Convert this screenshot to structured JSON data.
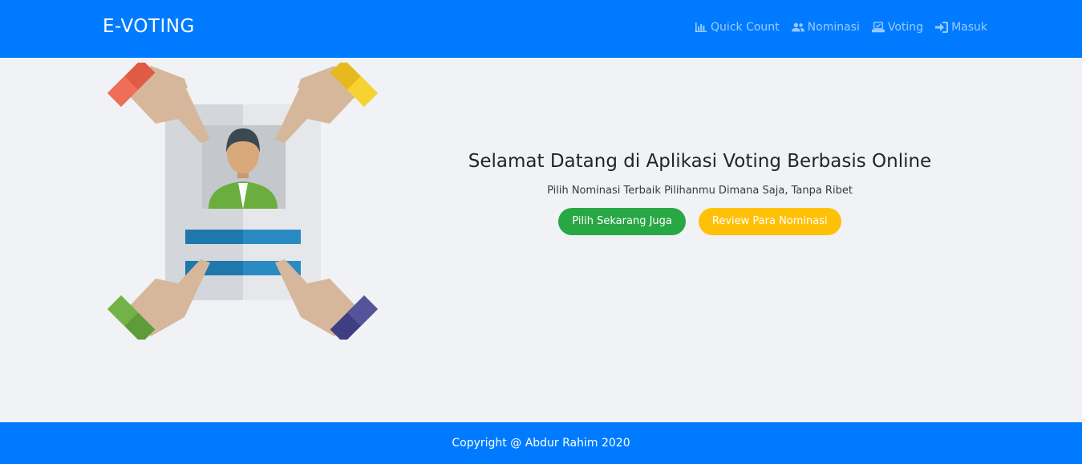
{
  "navbar": {
    "brand": "E-VOTING",
    "items": [
      {
        "label": "Quick Count",
        "icon": "chart-icon"
      },
      {
        "label": "Nominasi",
        "icon": "users-icon"
      },
      {
        "label": "Voting",
        "icon": "vote-box-icon"
      },
      {
        "label": "Masuk",
        "icon": "sign-in-icon"
      }
    ]
  },
  "hero": {
    "title": "Selamat Datang di Aplikasi Voting Berbasis Online",
    "subtitle": "Pilih Nominasi Terbaik Pilihanmu Dimana Saja, Tanpa Ribet",
    "primary_button": "Pilih Sekarang Juga",
    "secondary_button": "Review Para Nominasi"
  },
  "footer": {
    "copyright": "Copyright @ Abdur Rahim 2020"
  },
  "colors": {
    "primary": "#007bff",
    "success": "#28a745",
    "warning": "#ffc107",
    "background": "#f0f2f5"
  }
}
